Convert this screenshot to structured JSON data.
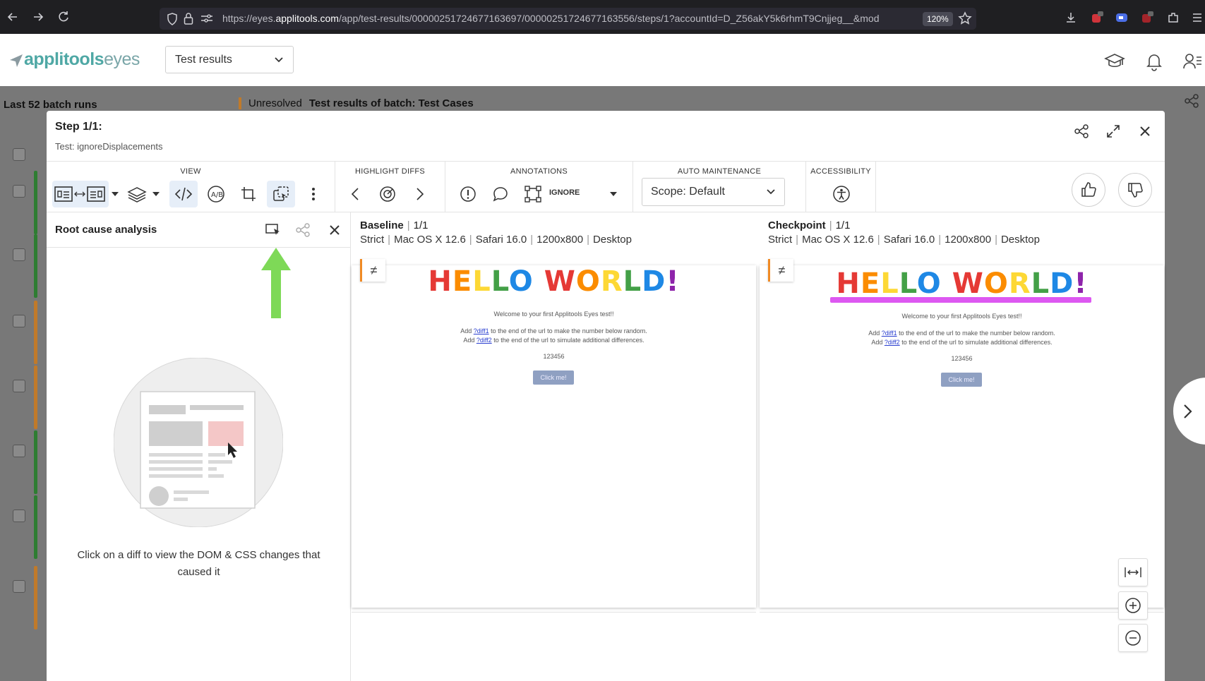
{
  "browser": {
    "url_prefix": "https://eyes.",
    "url_host": "applitools.com",
    "url_rest": "/app/test-results/00000251724677163697/00000251724677163556/steps/1?accountId=D_Z56akY5k6rhmT9Cnjjeg__&mod",
    "zoom": "120%"
  },
  "app": {
    "logo_brand": "applitools",
    "logo_product": "eyes",
    "section_select": "Test results"
  },
  "background": {
    "batch_runs_title": "Last 52 batch runs",
    "status": "Unresolved",
    "batch_title": "Test results of batch: Test Cases",
    "row_bar_colors": [
      "#2e7d32",
      "#2e7d32",
      "#c07a2a",
      "#c07a2a",
      "#2e7d32",
      "#2e7d32",
      "#c07a2a"
    ]
  },
  "modal": {
    "step_title": "Step 1/1:",
    "test_name": "Test: ignoreDisplacements"
  },
  "toolbar": {
    "view_label": "VIEW",
    "highlight_label": "HIGHLIGHT DIFFS",
    "annotations_label": "ANNOTATIONS",
    "ignore_label": "IGNORE",
    "auto_maintenance_label": "AUTO MAINTENANCE",
    "scope_value": "Scope: Default",
    "accessibility_label": "ACCESSIBILITY"
  },
  "rca": {
    "title": "Root cause analysis",
    "hint": "Click on a diff to view the DOM & CSS changes that caused it",
    "arrow_color": "#7ed957"
  },
  "baseline": {
    "title": "Baseline",
    "count": "1/1",
    "meta": [
      "Strict",
      "Mac OS X 12.6",
      "Safari 16.0",
      "1200x800",
      "Desktop"
    ]
  },
  "checkpoint": {
    "title": "Checkpoint",
    "count": "1/1",
    "meta": [
      "Strict",
      "Mac OS X 12.6",
      "Safari 16.0",
      "1200x800",
      "Desktop"
    ]
  },
  "screenshot": {
    "hello": "HELLO WORLD!",
    "welcome": "Welcome to your first Applitools Eyes test!!",
    "line1_pre": "Add ",
    "line1_link": "?diff1",
    "line1_post": " to the end of the url to make the number below random.",
    "line2_pre": "Add ",
    "line2_link": "?diff2",
    "line2_post": " to the end of the url to simulate additional differences.",
    "number": "123456",
    "button": "Click me!",
    "rainbow": [
      "#e53935",
      "#fb8c00",
      "#fdd835",
      "#43a047",
      "#1e88e5",
      "#8e24aa"
    ],
    "highlight_color": "#d946ef"
  }
}
